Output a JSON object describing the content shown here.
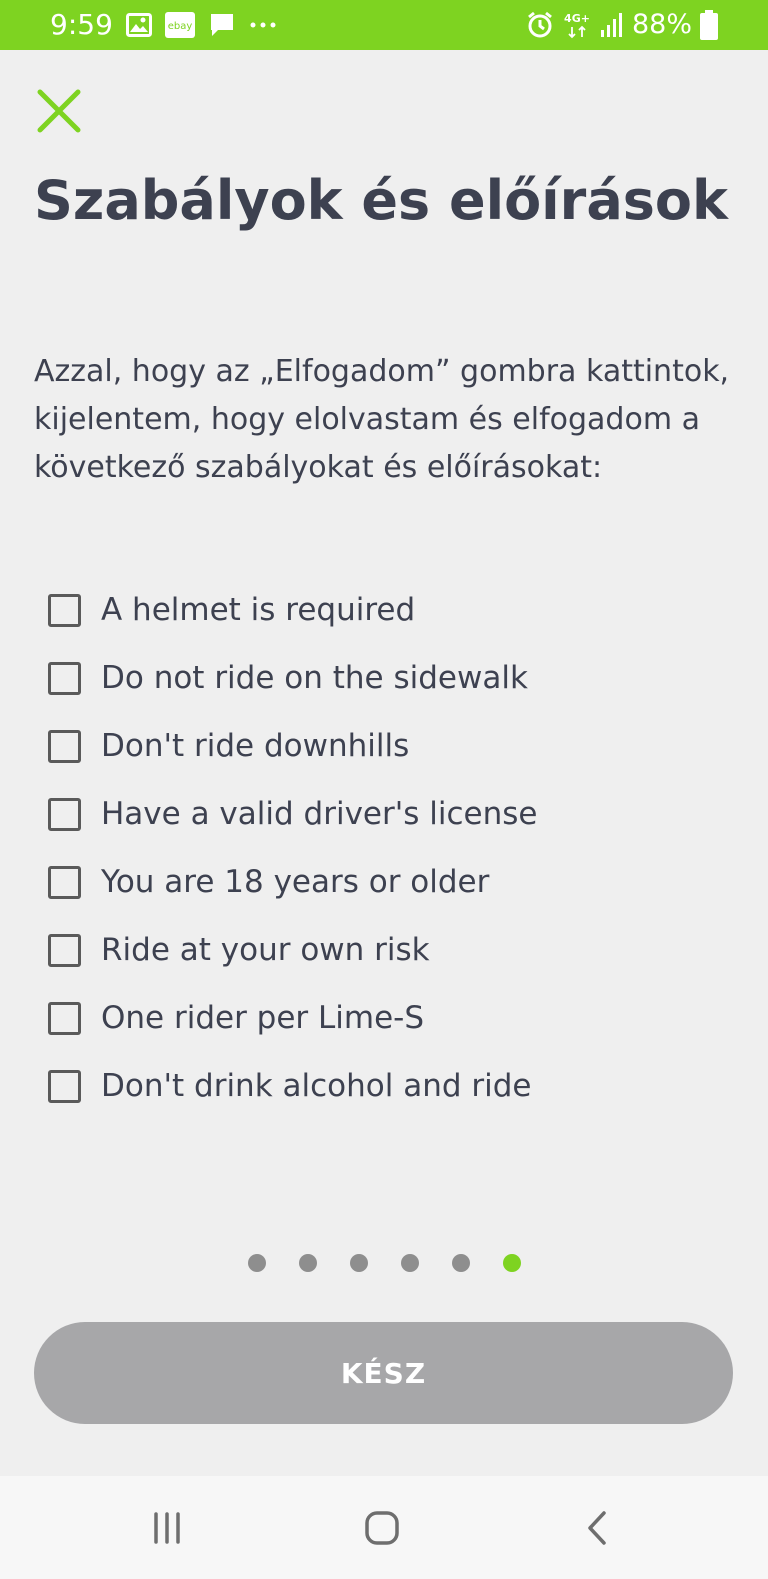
{
  "status_bar": {
    "time": "9:59",
    "notification_icons": [
      "image-icon",
      "ebay-icon",
      "message-icon",
      "more-icon"
    ],
    "ebay_text": "ebay",
    "right_icons": [
      "alarm-icon",
      "4g-icon",
      "signal-icon",
      "battery-icon"
    ],
    "network_label": "4G+",
    "battery": "88%",
    "color": "#7ed321"
  },
  "header": {
    "close_icon": "close-icon",
    "close_color": "#7ed321"
  },
  "title": "Szabályok és előírások",
  "intro": "Azzal, hogy az „Elfogadom” gombra kattintok, kijelentem, hogy elolvastam és elfogadom a következő szabályokat és előírásokat:",
  "rules": [
    {
      "label": "A helmet is required",
      "checked": false
    },
    {
      "label": "Do not ride on the sidewalk",
      "checked": false
    },
    {
      "label": "Don't ride downhills",
      "checked": false
    },
    {
      "label": "Have a valid driver's license",
      "checked": false
    },
    {
      "label": "You are 18 years or older",
      "checked": false
    },
    {
      "label": "Ride at your own risk",
      "checked": false
    },
    {
      "label": "One rider per Lime-S",
      "checked": false
    },
    {
      "label": "Don't drink alcohol and ride",
      "checked": false
    }
  ],
  "pager": {
    "total": 6,
    "active_index": 5,
    "active_color": "#7ed321",
    "inactive_color": "#8e8e8e"
  },
  "done_button": {
    "label": "KÉSZ",
    "color": "#a7a7a9"
  },
  "nav_bar": {
    "buttons": [
      "recent-apps-icon",
      "home-icon",
      "back-icon"
    ]
  }
}
